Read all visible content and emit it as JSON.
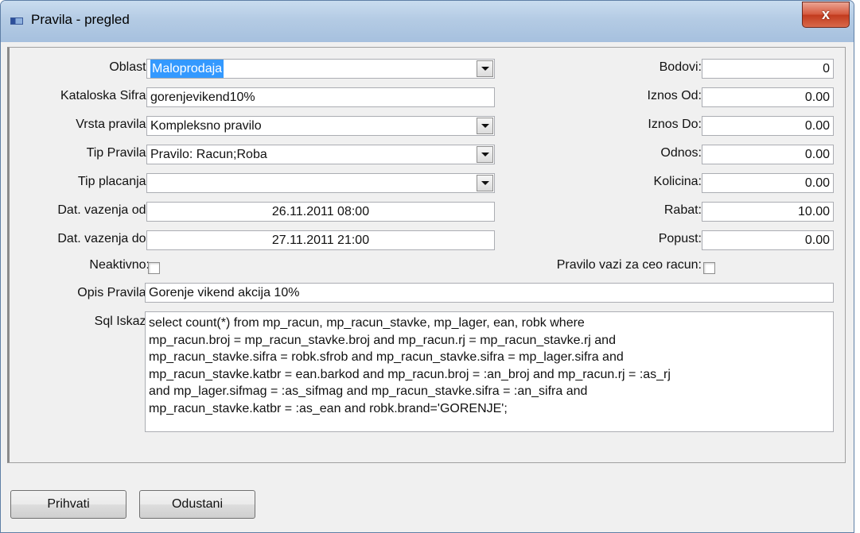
{
  "window": {
    "title": "Pravila - pregled",
    "close_glyph": "x"
  },
  "form": {
    "oblast": {
      "label": "Oblast:",
      "value": "Maloprodaja"
    },
    "kataloska_sifra": {
      "label": "Kataloska Sifra:",
      "value": "gorenjevikend10%"
    },
    "vrsta_pravila": {
      "label": "Vrsta pravila:",
      "value": "Kompleksno pravilo"
    },
    "tip_pravila": {
      "label": "Tip Pravila:",
      "value": "Pravilo: Racun;Roba"
    },
    "tip_placanja": {
      "label": "Tip placanja:",
      "value": ""
    },
    "dat_od": {
      "label": "Dat. vazenja od:",
      "value": "26.11.2011 08:00"
    },
    "dat_do": {
      "label": "Dat. vazenja do:",
      "value": "27.11.2011 21:00"
    },
    "neaktivno": {
      "label": "Neaktivno:",
      "checked": false
    },
    "opis": {
      "label": "Opis Pravila:",
      "value": "Gorenje vikend akcija 10%"
    },
    "sql": {
      "label": "Sql Iskaz:",
      "value": "select count(*) from mp_racun, mp_racun_stavke, mp_lager, ean, robk where\nmp_racun.broj = mp_racun_stavke.broj and mp_racun.rj = mp_racun_stavke.rj and\nmp_racun_stavke.sifra = robk.sfrob and mp_racun_stavke.sifra = mp_lager.sifra and\nmp_racun_stavke.katbr = ean.barkod and mp_racun.broj = :an_broj and mp_racun.rj = :as_rj\nand mp_lager.sifmag = :as_sifmag and mp_racun_stavke.sifra = :an_sifra and\nmp_racun_stavke.katbr = :as_ean and robk.brand='GORENJE';"
    }
  },
  "right": {
    "bodovi": {
      "label": "Bodovi:",
      "value": "0"
    },
    "iznos_od": {
      "label": "Iznos Od:",
      "value": "0.00"
    },
    "iznos_do": {
      "label": "Iznos Do:",
      "value": "0.00"
    },
    "odnos": {
      "label": "Odnos:",
      "value": "0.00"
    },
    "kolicina": {
      "label": "Kolicina:",
      "value": "0.00"
    },
    "rabat": {
      "label": "Rabat:",
      "value": "10.00"
    },
    "popust": {
      "label": "Popust:",
      "value": "0.00"
    },
    "ceo_racun": {
      "label": "Pravilo vazi za ceo racun:",
      "checked": false
    }
  },
  "buttons": {
    "prihvati": "Prihvati",
    "odustani": "Odustani"
  },
  "colors": {
    "selection": "#3399ff",
    "titlebar": "#b4cbe4",
    "close": "#c23b1e"
  }
}
